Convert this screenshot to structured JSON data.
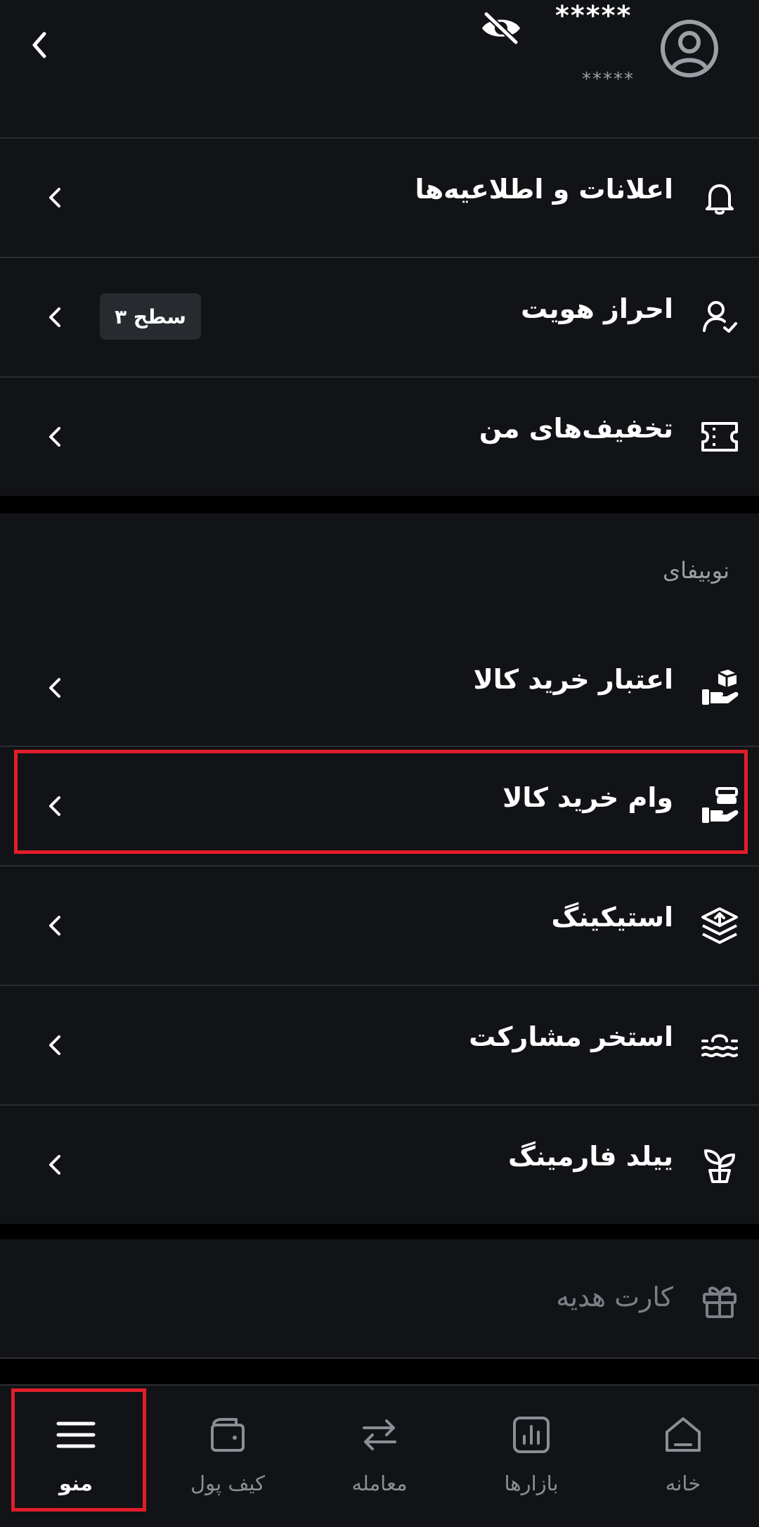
{
  "header": {
    "user_name": "*****",
    "user_sub": "*****"
  },
  "account_menu": [
    {
      "label": "اعلانات و اطلاعیه‌ها",
      "icon": "bell-icon"
    },
    {
      "label": "احراز هویت",
      "icon": "user-check-icon",
      "badge": "سطح ۳"
    },
    {
      "label": "تخفیف‌های من",
      "icon": "ticket-icon"
    }
  ],
  "nobifi": {
    "title": "نوبیفای",
    "items": [
      {
        "label": "اعتبار خرید کالا",
        "icon": "hand-box-icon"
      },
      {
        "label": "وام خرید کالا",
        "icon": "hand-stack-icon"
      },
      {
        "label": "استیکینگ",
        "icon": "layers-up-icon"
      },
      {
        "label": "استخر مشارکت",
        "icon": "pool-waves-icon"
      },
      {
        "label": "ییلد فارمینگ",
        "icon": "sprout-icon"
      }
    ]
  },
  "extra": {
    "gift_card": {
      "label": "کارت هدیه",
      "icon": "gift-icon"
    }
  },
  "bottom_nav": [
    {
      "label": "منو",
      "icon": "hamburger-menu-icon",
      "active": true
    },
    {
      "label": "کیف پول",
      "icon": "wallet-icon"
    },
    {
      "label": "معامله",
      "icon": "swap-arrows-icon"
    },
    {
      "label": "بازارها",
      "icon": "bar-chart-icon"
    },
    {
      "label": "خانه",
      "icon": "home-icon"
    }
  ],
  "colors": {
    "background": "#000000",
    "surface": "#121316",
    "divider": "#2b2d31",
    "highlight": "#e21d2a",
    "muted_text": "#9aa0a6"
  }
}
